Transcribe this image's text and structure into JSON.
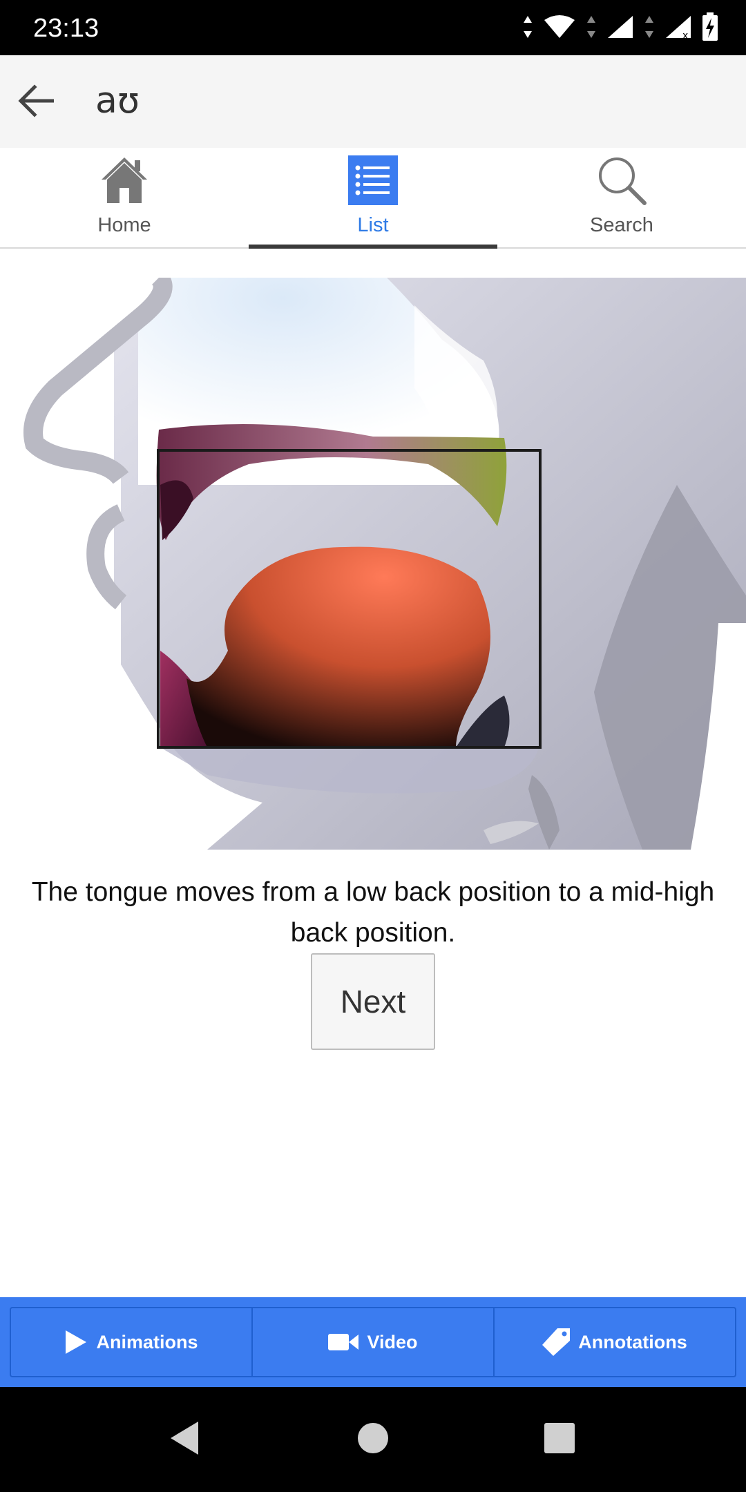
{
  "status_bar": {
    "time": "23:13"
  },
  "app_bar": {
    "title": "aʊ"
  },
  "tabs": [
    {
      "label": "Home",
      "icon": "home-icon",
      "active": false
    },
    {
      "label": "List",
      "icon": "list-icon",
      "active": true
    },
    {
      "label": "Search",
      "icon": "search-icon",
      "active": false
    }
  ],
  "content": {
    "description": "The tongue moves from a low back position to a mid-high back position.",
    "next_label": "Next"
  },
  "bottom_bar": {
    "animations_label": "Animations",
    "video_label": "Video",
    "annotations_label": "Annotations"
  },
  "colors": {
    "accent": "#2f7be6",
    "toolbar": "#3b7cf0",
    "tongue": "#e8694a"
  }
}
